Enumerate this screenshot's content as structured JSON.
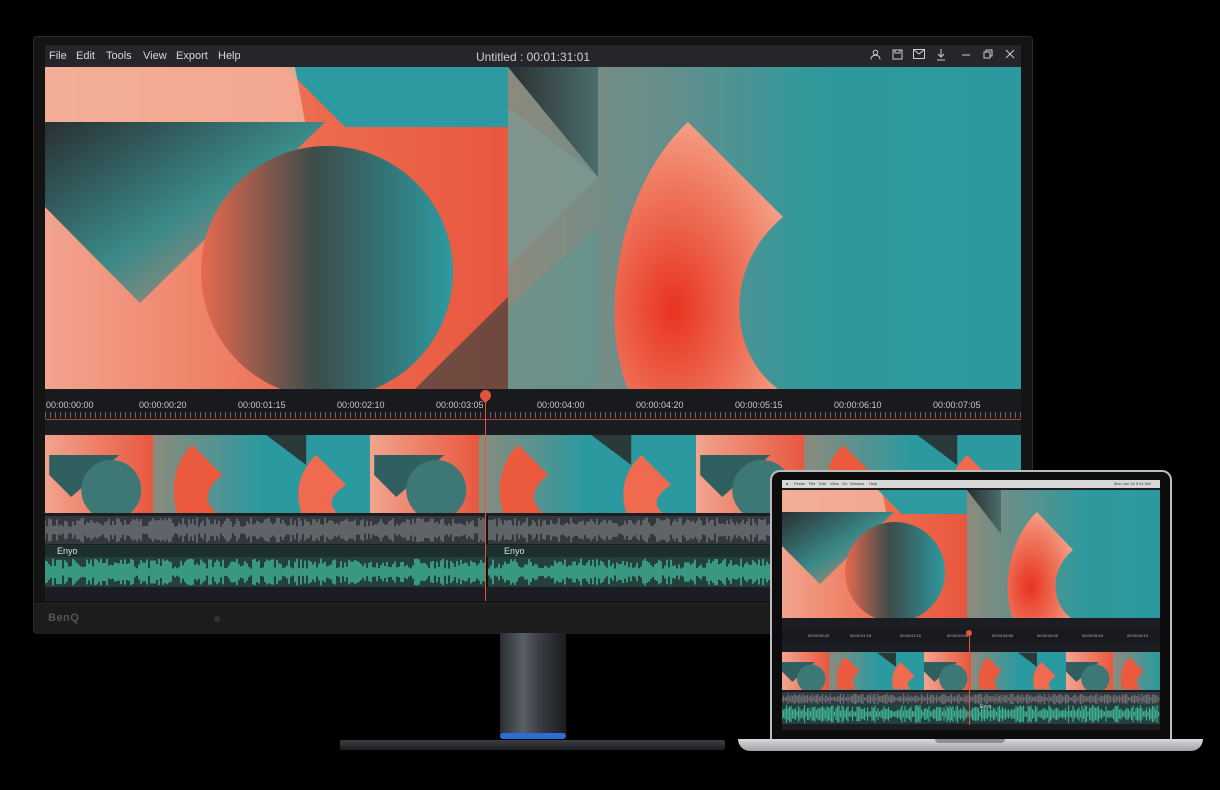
{
  "app": {
    "title": "Untitled : 00:01:31:01",
    "menu": [
      "File",
      "Edit",
      "Tools",
      "View",
      "Export",
      "Help"
    ],
    "window_icons": [
      "user-icon",
      "save-icon",
      "mail-icon",
      "download-icon",
      "minimize-icon",
      "restore-icon",
      "close-icon"
    ]
  },
  "timeline": {
    "ticks": [
      "00:00:00:00",
      "00:00:00:20",
      "00:00:01:15",
      "00:00:02:10",
      "00:00:03:05",
      "00:00:04:00",
      "00:00:04:20",
      "00:00:05:15",
      "00:00:06:10",
      "00:00:07:05"
    ],
    "playhead_time": "00:00:03:05",
    "audio_clip_labels": [
      "Enyo",
      "Enyo"
    ]
  },
  "monitor": {
    "brand": "BenQ"
  },
  "laptop": {
    "menu": [
      "Finder",
      "File",
      "Edit",
      "View",
      "Go",
      "Window",
      "Help"
    ],
    "clock": "Mon Jun 22  9:41 AM",
    "ticks": [
      "00:00:00:20",
      "00:00:01:15",
      "00:00:02:10",
      "00:00:03:05",
      "00:00:04:00",
      "00:00:04:20",
      "00:00:05:15",
      "00:00:06:10"
    ],
    "audio_clip_label": "Enyo"
  },
  "colors": {
    "accent": "#e5533b",
    "teal": "#2a9aa0",
    "coral": "#ec6a4d",
    "playhead": "#e5533b"
  }
}
